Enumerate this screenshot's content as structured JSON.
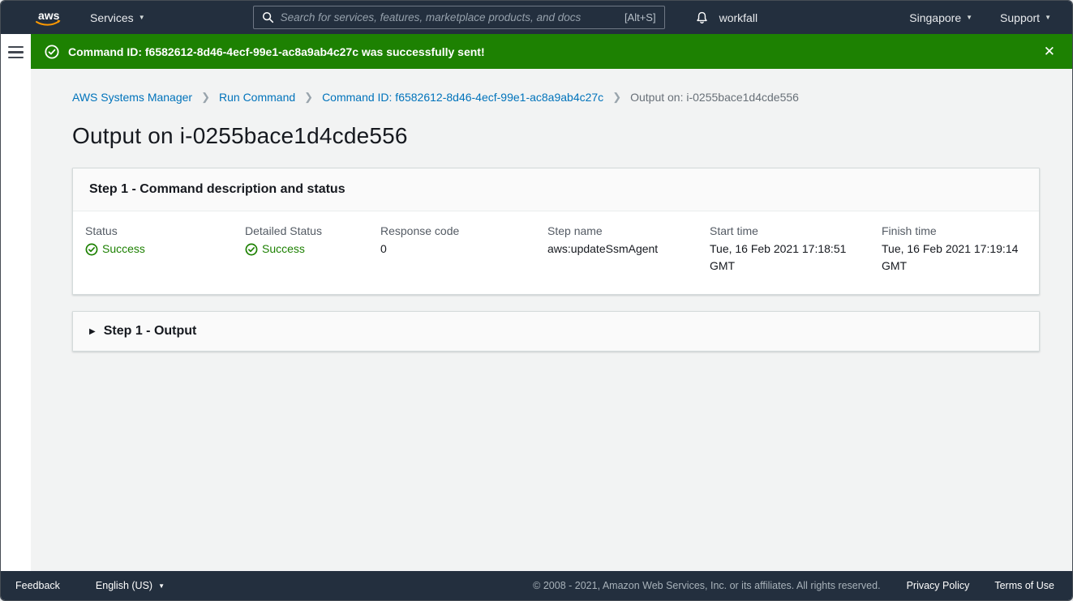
{
  "topnav": {
    "logo": "aws",
    "services_label": "Services",
    "search": {
      "placeholder": "Search for services, features, marketplace products, and docs",
      "shortcut": "[Alt+S]"
    },
    "account_label": "workfall",
    "region_label": "Singapore",
    "support_label": "Support"
  },
  "flashbar": {
    "message": "Command ID: f6582612-8d46-4ecf-99e1-ac8a9ab4c27c was successfully sent!"
  },
  "breadcrumb": {
    "items": [
      {
        "label": "AWS Systems Manager"
      },
      {
        "label": "Run Command"
      },
      {
        "label": "Command ID: f6582612-8d46-4ecf-99e1-ac8a9ab4c27c"
      },
      {
        "label": "Output on: i-0255bace1d4cde556"
      }
    ]
  },
  "page": {
    "title": "Output on i-0255bace1d4cde556"
  },
  "step_card": {
    "title": "Step 1 - Command description and status",
    "fields": [
      {
        "label": "Status",
        "value": "Success"
      },
      {
        "label": "Detailed Status",
        "value": "Success"
      },
      {
        "label": "Response code",
        "value": "0"
      },
      {
        "label": "Step name",
        "value": "aws:updateSsmAgent"
      },
      {
        "label": "Start time",
        "value": "Tue, 16 Feb 2021 17:18:51 GMT"
      },
      {
        "label": "Finish time",
        "value": "Tue, 16 Feb 2021 17:19:14 GMT"
      }
    ]
  },
  "output_card": {
    "title": "Step 1 - Output"
  },
  "footer": {
    "feedback_label": "Feedback",
    "language_label": "English (US)",
    "copyright": "© 2008 - 2021, Amazon Web Services, Inc. or its affiliates. All rights reserved.",
    "privacy_label": "Privacy Policy",
    "terms_label": "Terms of Use"
  },
  "colors": {
    "nav_dark": "#232f3e",
    "success_green": "#1d8102",
    "link_blue": "#0073bb",
    "content_bg": "#f2f3f3",
    "aws_orange": "#ff9900"
  }
}
